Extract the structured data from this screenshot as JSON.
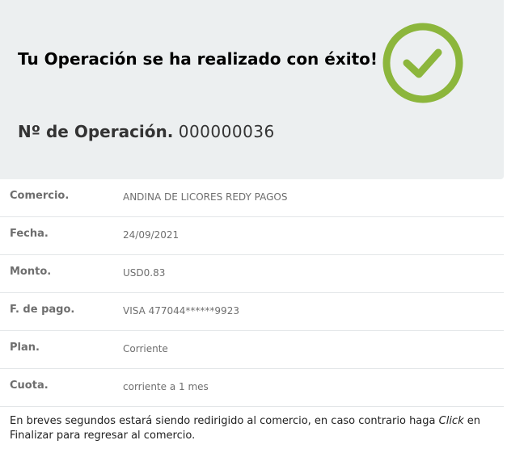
{
  "header": {
    "success_message": "Tu Operación se ha realizado con éxito!",
    "operation_label": "Nº de Operación.",
    "operation_number": "000000036",
    "status_icon": "check-circle-icon",
    "accent_color": "#8cb63c",
    "panel_color": "#eceff0"
  },
  "details": [
    {
      "label": "Comercio.",
      "value": "ANDINA DE LICORES REDY PAGOS"
    },
    {
      "label": "Fecha.",
      "value": "24/09/2021"
    },
    {
      "label": "Monto.",
      "value": "USD0.83"
    },
    {
      "label": "F. de pago.",
      "value": "VISA 477044******9923"
    },
    {
      "label": "Plan.",
      "value": "Corriente"
    },
    {
      "label": "Cuota.",
      "value": "corriente a 1 mes"
    }
  ],
  "footer": {
    "text_before": "En breves segundos estará siendo redirigido al comercio, en caso contrario haga ",
    "click_word": "Click",
    "text_after": " en Finalizar para regresar al comercio."
  }
}
